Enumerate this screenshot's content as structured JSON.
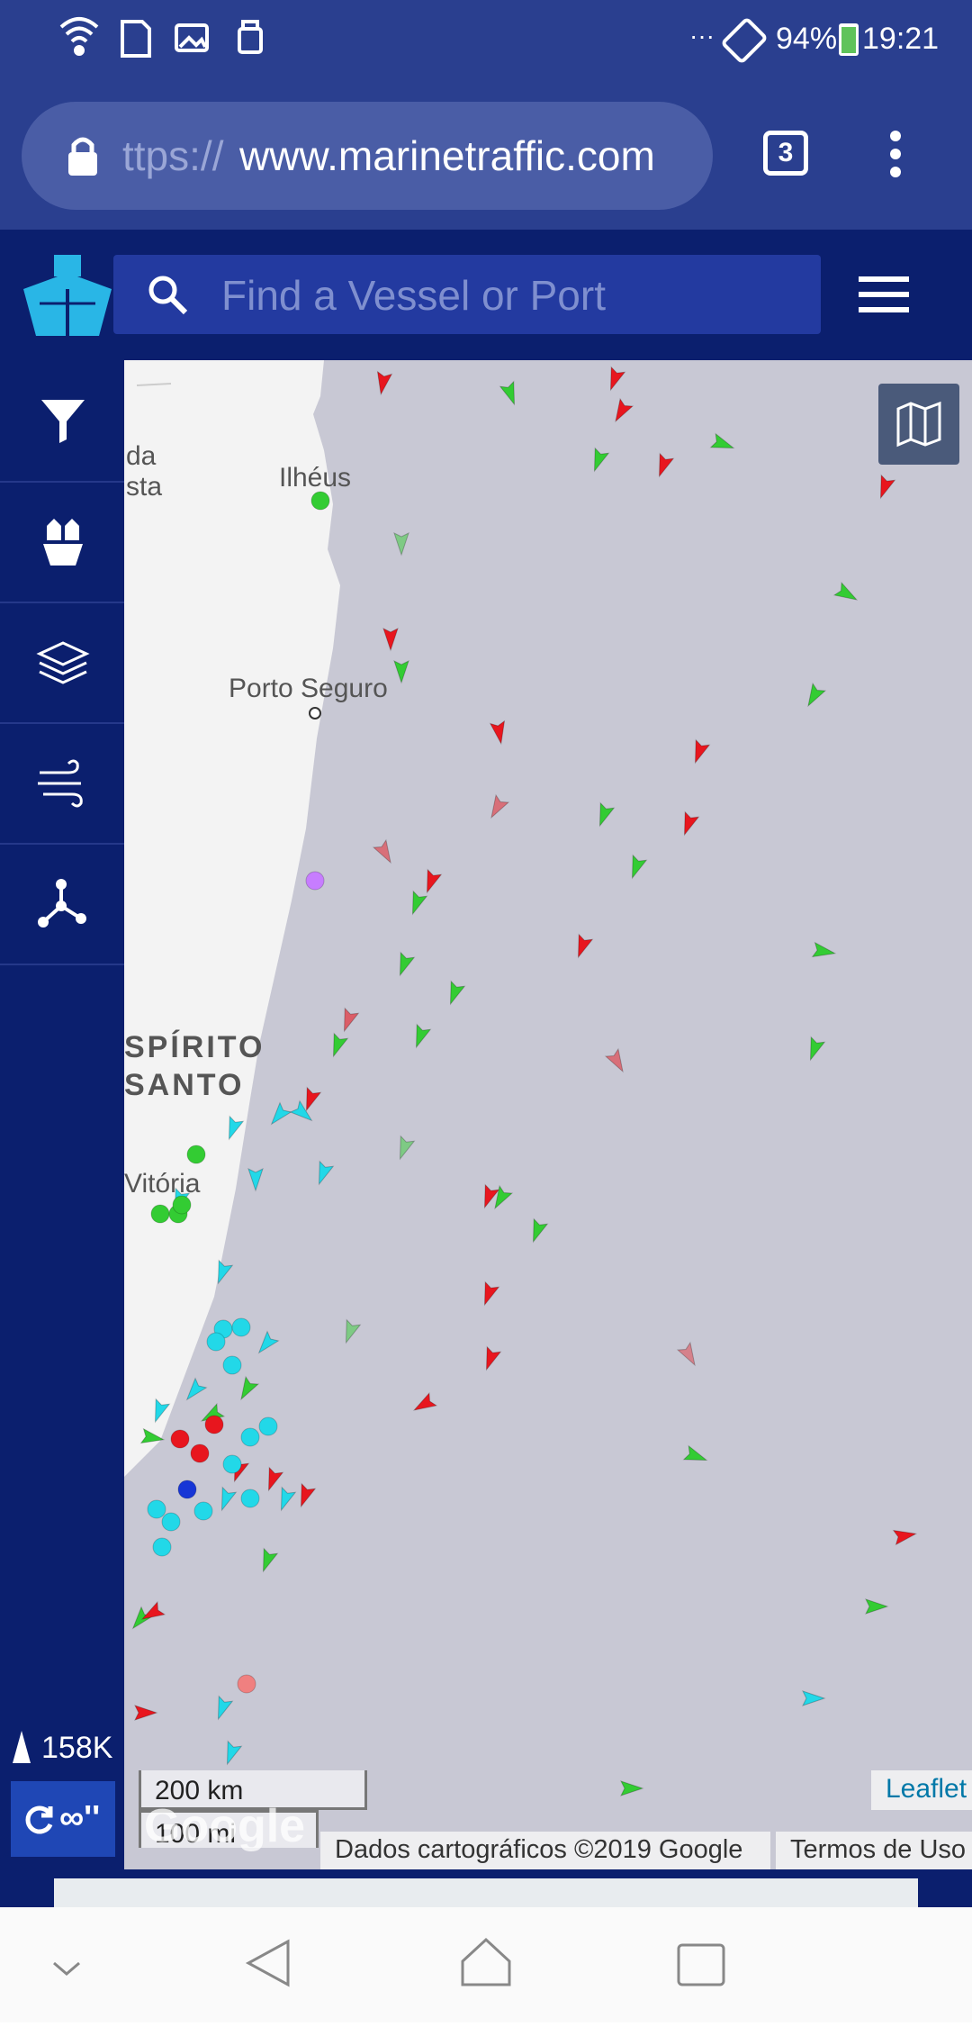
{
  "status": {
    "left_icons": [
      "wifi-icon",
      "sd-card-icon",
      "image-icon",
      "usb-icon"
    ],
    "dots": "···",
    "battery": "94%",
    "time": "19:21"
  },
  "browser": {
    "url_prefix": "ttps://",
    "url_domain": "www.marinetraffic.com",
    "tab_count": "3"
  },
  "app": {
    "search_placeholder": "Find a Vessel or Port"
  },
  "sidebar": {
    "items": [
      "filter-icon",
      "my-fleets-icon",
      "layers-icon",
      "weather-icon",
      "network-icon"
    ],
    "vessel_count": "158K",
    "refresh_label": "∞''"
  },
  "map": {
    "labels": {
      "da_sta_1": "da",
      "da_sta_2": "sta",
      "ilheus": "Ilhéus",
      "porto_seguro": "Porto Seguro",
      "espirito_1": "SPÍRITO",
      "espirito_2": "SANTO",
      "vitoria": "Vitória"
    },
    "scale_km": "200 km",
    "scale_mi": "100 mi",
    "google": "Google",
    "attribution": "Dados cartográficos ©2019 Google",
    "terms": "Termos de Uso",
    "leaflet": "Leaflet",
    "colors": {
      "water": "#c8c8d4",
      "land": "#f3f3f3",
      "cargo": "#33cc33",
      "tanker": "#e8161e",
      "passenger": "#22d8e8"
    }
  }
}
